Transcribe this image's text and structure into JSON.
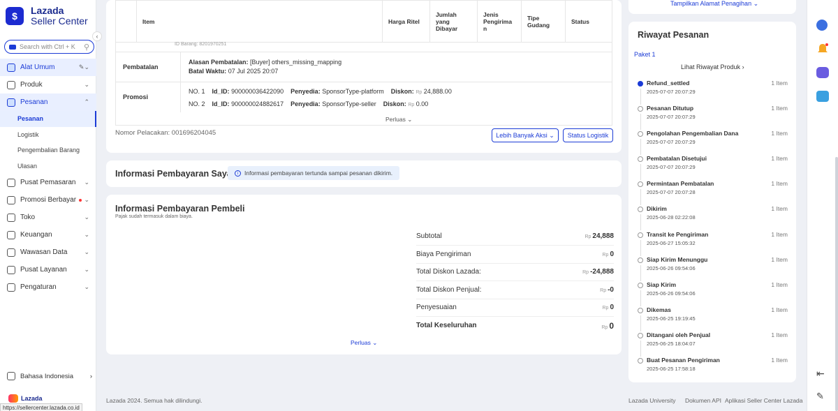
{
  "logo": {
    "mark": "$",
    "line1": "Lazada",
    "line2": "Seller Center"
  },
  "search": {
    "placeholder": "Search with Ctrl + K"
  },
  "menu": [
    {
      "label": "Alat Umum",
      "icon": "bulb-icon"
    },
    {
      "label": "Produk",
      "icon": "box-icon"
    },
    {
      "label": "Pesanan",
      "icon": "order-icon"
    },
    {
      "label": "Pusat Pemasaran",
      "icon": "target-icon"
    },
    {
      "label": "Promosi Berbayar",
      "icon": "megaphone-icon"
    },
    {
      "label": "Toko",
      "icon": "store-icon"
    },
    {
      "label": "Keuangan",
      "icon": "wallet-icon"
    },
    {
      "label": "Wawasan Data",
      "icon": "chart-icon"
    },
    {
      "label": "Pusat Layanan",
      "icon": "headset-icon"
    },
    {
      "label": "Pengaturan",
      "icon": "gear-icon"
    }
  ],
  "submenu": [
    "Pesanan",
    "Logistik",
    "Pengembalian Barang",
    "Ulasan"
  ],
  "language": "Bahasa Indonesia",
  "footer_logo": "Lazada",
  "url_tip": "https://sellercenter.lazada.co.id",
  "table": {
    "headers": [
      "Item",
      "Harga Ritel",
      "Jumlah yang Dibayar",
      "Jenis Pengirima n",
      "Tipe Gudang",
      "Status"
    ],
    "id_row": "ID Barang: 8201970251"
  },
  "pembatalan": {
    "label": "Pembatalan",
    "reason_label": "Alasan Pembatalan:",
    "reason": "[Buyer] others_missing_mapping",
    "deadline_label": "Batal Waktu:",
    "deadline": "07 Jul 2025 20:07"
  },
  "promosi": {
    "label": "Promosi",
    "rows": [
      {
        "no": "NO. 1",
        "id_label": "Id_ID:",
        "id": "900000036422090",
        "prov_label": "Penyedia:",
        "prov": "SponsorType-platform",
        "disc_label": "Diskon:",
        "rp": "Rp",
        "disc": "24,888.00"
      },
      {
        "no": "NO. 2",
        "id_label": "Id_ID:",
        "id": "900000024882617",
        "prov_label": "Penyedia:",
        "prov": "SponsorType-seller",
        "disc_label": "Diskon:",
        "rp": "Rp",
        "disc": "0.00"
      }
    ]
  },
  "perluas": "Perluas",
  "nomor": "Nomor Pelacakan: 001696204045",
  "buttons": {
    "more": "Lebih Banyak Aksi",
    "logistic": "Status Logistik"
  },
  "payment_info": {
    "title": "Informasi Pembayaran Saya",
    "note": "Informasi pembayaran tertunda sampai pesanan dikirim."
  },
  "buyer_payment": {
    "title": "Informasi Pembayaran Pembeli",
    "subtitle": "Pajak sudah termasuk dalam biaya.",
    "rows": [
      {
        "label": "Subtotal",
        "rp": "Rp",
        "value": "24,888"
      },
      {
        "label": "Biaya Pengiriman",
        "rp": "Rp",
        "value": "0"
      },
      {
        "label": "Total Diskon Lazada:",
        "rp": "Rp",
        "value": "-24,888"
      },
      {
        "label": "Total Diskon Penjual:",
        "rp": "Rp",
        "value": "-0"
      },
      {
        "label": "Penyesuaian",
        "rp": "Rp",
        "value": "0"
      },
      {
        "label": "Total Keseluruhan",
        "rp": "Rp",
        "value": "0"
      }
    ]
  },
  "billing_link": "Tampilkan Alamat Penagihan",
  "history": {
    "title": "Riwayat Pesanan",
    "package": "Paket 1",
    "product_history": "Lihat Riwayat Produk",
    "events": [
      {
        "name": "Refund_settled",
        "qty": "1 Item",
        "time": "2025-07-07 20:07:29"
      },
      {
        "name": "Pesanan Ditutup",
        "qty": "1 Item",
        "time": "2025-07-07 20:07:29"
      },
      {
        "name": "Pengolahan Pengembalian Dana",
        "qty": "1 Item",
        "time": "2025-07-07 20:07:29"
      },
      {
        "name": "Pembatalan Disetujui",
        "qty": "1 Item",
        "time": "2025-07-07 20:07:29"
      },
      {
        "name": "Permintaan Pembatalan",
        "qty": "1 Item",
        "time": "2025-07-07 20:07:28"
      },
      {
        "name": "Dikirim",
        "qty": "1 Item",
        "time": "2025-06-28 02:22:08"
      },
      {
        "name": "Transit ke Pengiriman",
        "qty": "1 Item",
        "time": "2025-06-27 15:05:32"
      },
      {
        "name": "Siap Kirim Menunggu",
        "qty": "1 Item",
        "time": "2025-06-26 09:54:06"
      },
      {
        "name": "Siap Kirim",
        "qty": "1 Item",
        "time": "2025-06-26 09:54:06"
      },
      {
        "name": "Dikemas",
        "qty": "1 Item",
        "time": "2025-06-25 19:19:45"
      },
      {
        "name": "Ditangani oleh Penjual",
        "qty": "1 Item",
        "time": "2025-06-25 18:04:07"
      },
      {
        "name": "Buat Pesanan Pengiriman",
        "qty": "1 Item",
        "time": "2025-06-25 17:58:18"
      }
    ]
  },
  "footer": {
    "copyright": "Lazada 2024. Semua hak dilindungi.",
    "links": [
      "Lazada University",
      "Dokumen API",
      "Aplikasi Seller Center Lazada"
    ]
  },
  "toolbar_icons": [
    "lazada-chat-icon",
    "bell-icon",
    "message-icon",
    "upload-icon",
    "logout-icon",
    "edit-icon"
  ]
}
